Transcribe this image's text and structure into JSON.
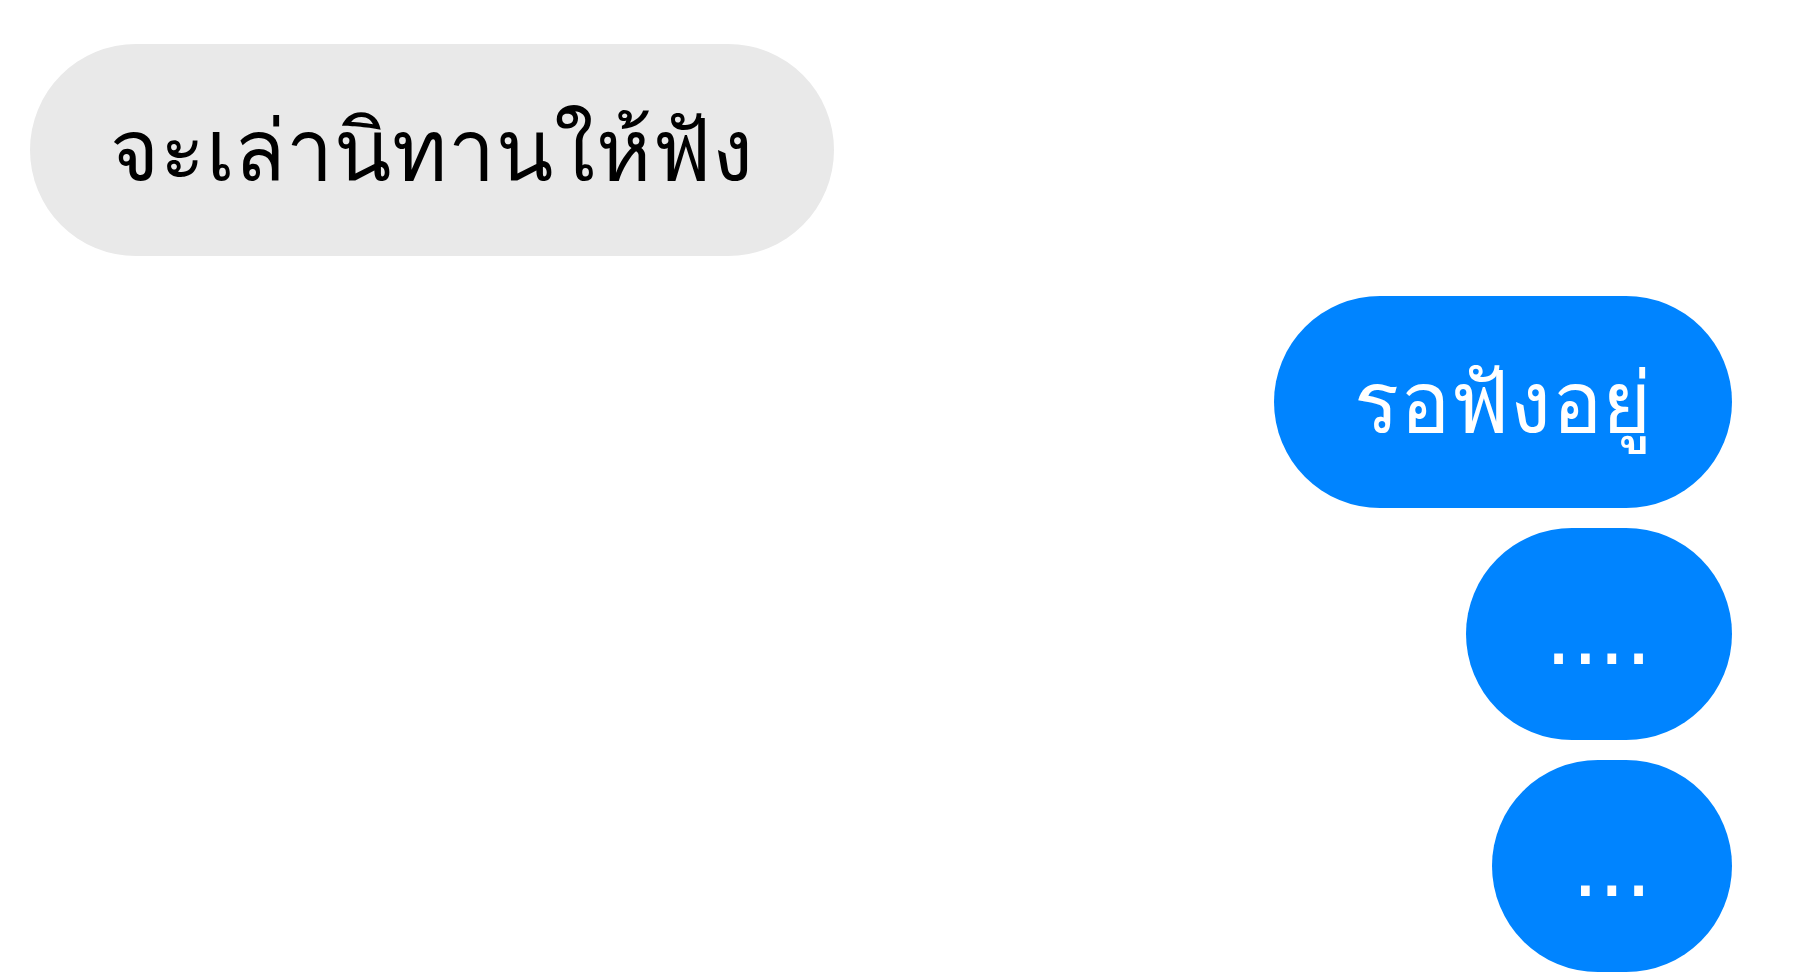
{
  "messages": [
    {
      "kind": "received",
      "text": "จะเล่านิทานให้ฟัง"
    },
    {
      "kind": "sent",
      "text": "รอฟังอยู่"
    },
    {
      "kind": "sent",
      "text": "...."
    },
    {
      "kind": "sent",
      "text": "..."
    }
  ]
}
